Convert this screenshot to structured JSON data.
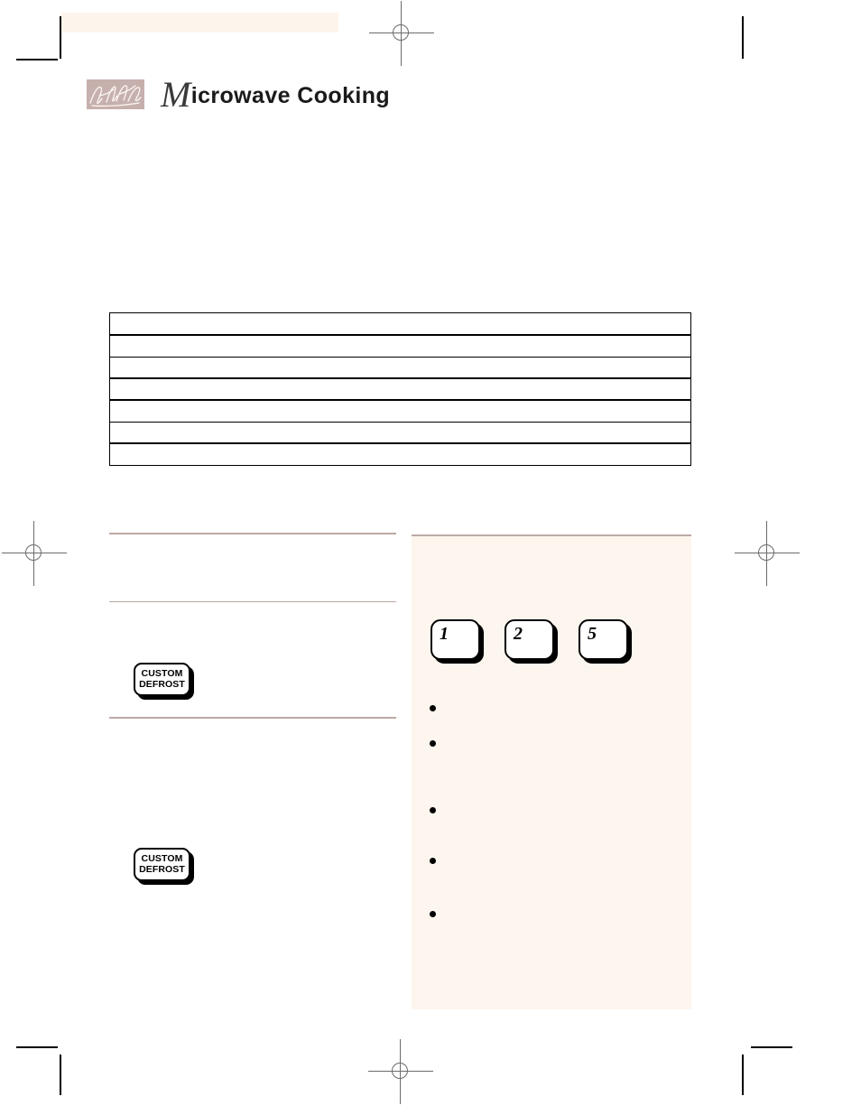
{
  "document": {
    "page_title": "Microwave Cooking",
    "title_dropcap": "M",
    "title_rest": "icrowave Cooking",
    "logo_name": "signature-logo",
    "colors": {
      "accent_mauve": "#bca9a4",
      "logo_box": "#c6b0ad",
      "panel_tint": "#fdf6ee",
      "bleed_band": "#fdf5ec",
      "rule_black": "#000000",
      "reg_mark": "#6b6b6b"
    }
  },
  "bleed_band": {
    "label": ""
  },
  "chart_table": {
    "caption": "",
    "columns": [
      ""
    ],
    "rows": [
      {
        "cells": [
          ""
        ],
        "rule": "thick"
      },
      {
        "cells": [
          ""
        ],
        "rule": "thin"
      },
      {
        "cells": [
          ""
        ],
        "rule": "thick"
      },
      {
        "cells": [
          ""
        ],
        "rule": "thick"
      },
      {
        "cells": [
          ""
        ],
        "rule": "thin"
      },
      {
        "cells": [
          ""
        ],
        "rule": "thick"
      },
      {
        "cells": [
          ""
        ],
        "rule": "none"
      }
    ]
  },
  "left_column": {
    "blocks": [
      {
        "heading": "",
        "body": ""
      },
      {
        "heading": "",
        "body": ""
      },
      {
        "heading": "",
        "body": ""
      }
    ],
    "buttons": [
      {
        "line1": "CUSTOM",
        "line2": "DEFROST"
      },
      {
        "line1": "CUSTOM",
        "line2": "DEFROST"
      }
    ]
  },
  "side_panel": {
    "title": "",
    "intro": "",
    "keypad": [
      {
        "digit": "1"
      },
      {
        "digit": "2"
      },
      {
        "digit": "5"
      }
    ],
    "bullets": [
      {
        "text": ""
      },
      {
        "text": ""
      },
      {
        "text": ""
      },
      {
        "text": ""
      },
      {
        "text": ""
      }
    ]
  },
  "prepress": {
    "registration_marks": [
      {
        "name": "reg-top-center"
      },
      {
        "name": "reg-left-middle"
      },
      {
        "name": "reg-right-middle"
      },
      {
        "name": "reg-bottom-center"
      }
    ],
    "crop_marks": [
      {
        "name": "crop-top-left-v"
      },
      {
        "name": "crop-top-left-h"
      },
      {
        "name": "crop-top-right-v"
      },
      {
        "name": "crop-bottom-left-h"
      },
      {
        "name": "crop-bottom-left-v"
      },
      {
        "name": "crop-bottom-right-h"
      },
      {
        "name": "crop-bottom-right-v"
      }
    ]
  }
}
